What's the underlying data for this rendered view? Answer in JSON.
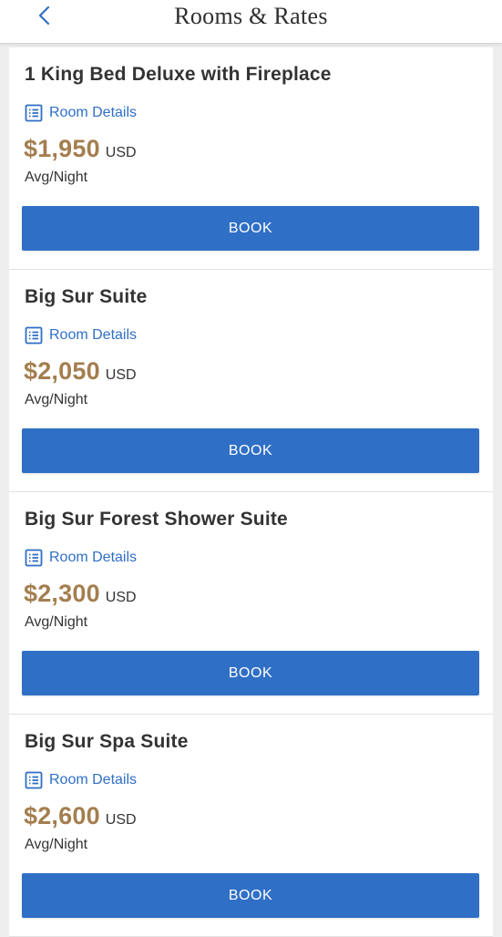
{
  "header": {
    "title": "Rooms & Rates",
    "back_icon": "chevron-left-icon"
  },
  "colors": {
    "accent": "#2f6fc6",
    "price": "#a47e4f",
    "text": "#333333"
  },
  "rooms": [
    {
      "name": "1 King Bed Deluxe with Fireplace",
      "details_label": "Room Details",
      "price": "$1,950",
      "currency": "USD",
      "per_night": "Avg/Night",
      "book_label": "BOOK"
    },
    {
      "name": "Big Sur Suite",
      "details_label": "Room Details",
      "price": "$2,050",
      "currency": "USD",
      "per_night": "Avg/Night",
      "book_label": "BOOK"
    },
    {
      "name": "Big Sur Forest Shower Suite",
      "details_label": "Room Details",
      "price": "$2,300",
      "currency": "USD",
      "per_night": "Avg/Night",
      "book_label": "BOOK"
    },
    {
      "name": "Big Sur Spa Suite",
      "details_label": "Room Details",
      "price": "$2,600",
      "currency": "USD",
      "per_night": "Avg/Night",
      "book_label": "BOOK"
    }
  ]
}
